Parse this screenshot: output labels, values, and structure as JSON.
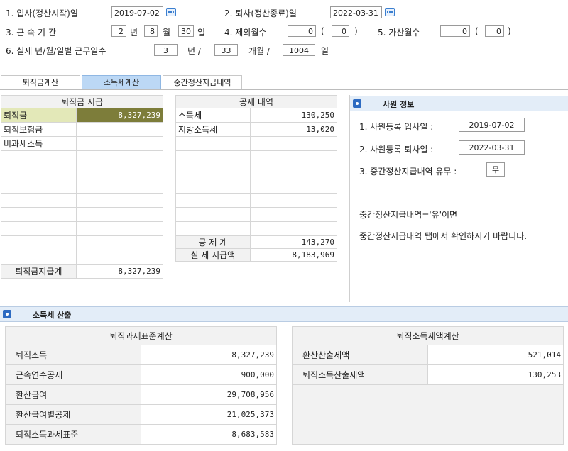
{
  "form": {
    "row1": {
      "item1_label": "1. 입사(정산시작)일",
      "start_date": "2019-07-02",
      "item2_label": "2. 퇴사(정산종료)일",
      "end_date": "2022-03-31"
    },
    "row2": {
      "item3_label": "3. 근   속  기   간",
      "years": "2",
      "years_unit": "년",
      "months": "8",
      "months_unit": "월",
      "days": "30",
      "days_unit": "일",
      "item4_label": "4. 제외월수",
      "excl_months": "0",
      "excl_paren_val": "0",
      "item5_label": "5. 가산월수",
      "add_months": "0",
      "add_paren_val": "0",
      "open_paren": "(",
      "close_paren": ")"
    },
    "row3": {
      "item6_label": "6. 실제 년/월/일별 근무일수",
      "years": "3",
      "years_unit": "년 /",
      "months": "33",
      "months_unit": "개월 /",
      "days": "1004",
      "days_unit": "일"
    }
  },
  "tabs": [
    {
      "label": "퇴직금계산",
      "active": false
    },
    {
      "label": "소득세계산",
      "active": true
    },
    {
      "label": "중간정산지급내역",
      "active": false
    }
  ],
  "payment": {
    "header": "퇴직금 지급",
    "rows": [
      {
        "label": "퇴직금",
        "value": "8,327,239"
      },
      {
        "label": "퇴직보험금",
        "value": ""
      },
      {
        "label": "비과세소득",
        "value": ""
      }
    ],
    "total_label": "퇴직금지급계",
    "total_value": "8,327,239"
  },
  "deduction": {
    "header": "공제 내역",
    "rows": [
      {
        "label": "소득세",
        "value": "130,250"
      },
      {
        "label": "지방소득세",
        "value": "13,020"
      }
    ],
    "sum_label": "공  제  계",
    "sum_value": "143,270",
    "net_label": "실 제 지급액",
    "net_value": "8,183,969"
  },
  "employee_info": {
    "title": "사원 정보",
    "reg_start_label": "1. 사원등록 입사일 :",
    "reg_start": "2019-07-02",
    "reg_end_label": "2. 사원등록 퇴사일 :",
    "reg_end": "2022-03-31",
    "interim_label": "3. 중간정산지급내역 유무 :",
    "interim_value": "무",
    "note1": "중간정산지급내역='유'이면",
    "note2": "중간정산지급내역 탭에서 확인하시기 바랍니다."
  },
  "tax_calc": {
    "title": "소득세 산출",
    "left_header": "퇴직과세표준계산",
    "left_rows": [
      {
        "label": "퇴직소득",
        "value": "8,327,239"
      },
      {
        "label": "근속연수공제",
        "value": "900,000"
      },
      {
        "label": "환산급여",
        "value": "29,708,956"
      },
      {
        "label": "환산급여별공제",
        "value": "21,025,373"
      },
      {
        "label": "퇴직소득과세표준",
        "value": "8,683,583"
      }
    ],
    "right_header": "퇴직소득세액계산",
    "right_rows": [
      {
        "label": "환산산출세액",
        "value": "521,014"
      },
      {
        "label": "퇴직소득산출세액",
        "value": "130,253"
      }
    ]
  },
  "colors": {
    "accent": "#2d6bc2",
    "active_tab": "#bcd8f5",
    "selected_cell": "#7d7d3a",
    "panel_header": "#e3edf8"
  }
}
